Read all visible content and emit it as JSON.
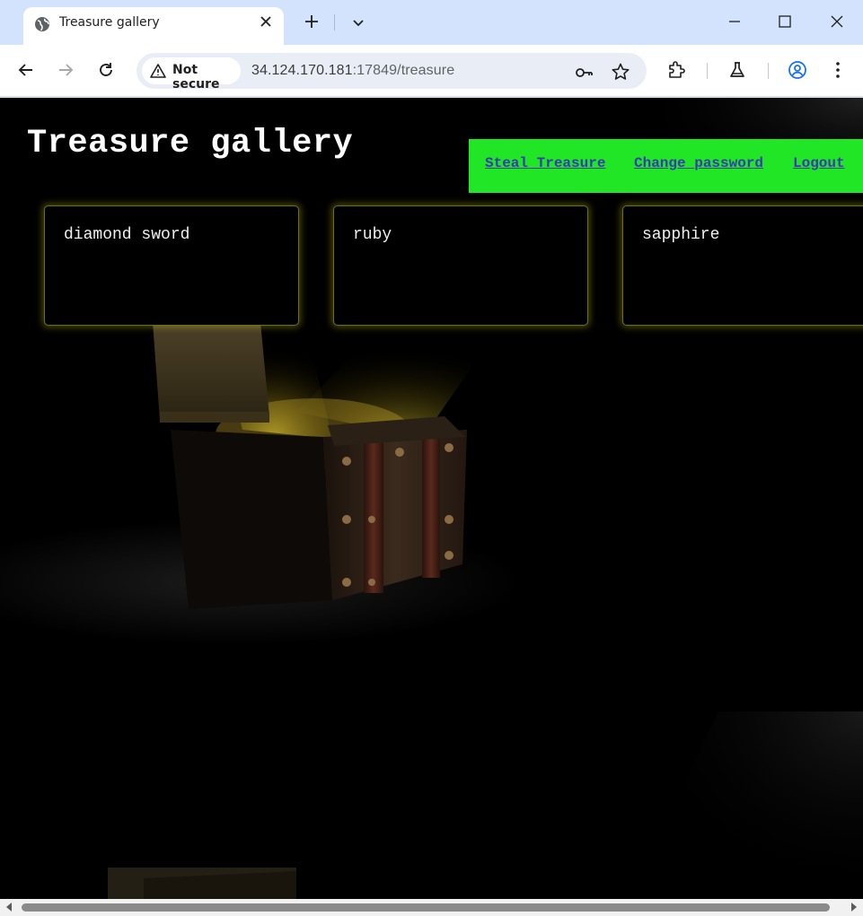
{
  "browser": {
    "tab_title": "Treasure gallery",
    "security_label": "Not secure",
    "url_host": "34.124.170.181",
    "url_rest": ":17849/treasure",
    "icons": {
      "tab": "globe-icon",
      "tab_close": "close-icon",
      "new_tab": "plus-icon",
      "tab_search": "chevron-down-icon",
      "minimize": "minimize-icon",
      "maximize": "maximize-icon",
      "close_window": "close-icon",
      "back": "back-arrow-icon",
      "forward": "forward-arrow-icon",
      "reload": "reload-icon",
      "security": "warning-triangle-icon",
      "password": "key-icon",
      "bookmark": "star-icon",
      "extensions": "puzzle-icon",
      "labs": "flask-icon",
      "profile": "profile-icon",
      "menu": "kebab-menu-icon"
    }
  },
  "page": {
    "title": "Treasure gallery",
    "nav": {
      "steal": "Steal Treasure",
      "change_password": "Change password",
      "logout": "Logout"
    },
    "treasures": [
      "diamond sword",
      "ruby",
      "sapphire"
    ],
    "colors": {
      "nav_bg": "#20e626",
      "nav_link": "#3a3ab0",
      "card_glow": "#d2d228",
      "page_bg": "#000000"
    }
  }
}
